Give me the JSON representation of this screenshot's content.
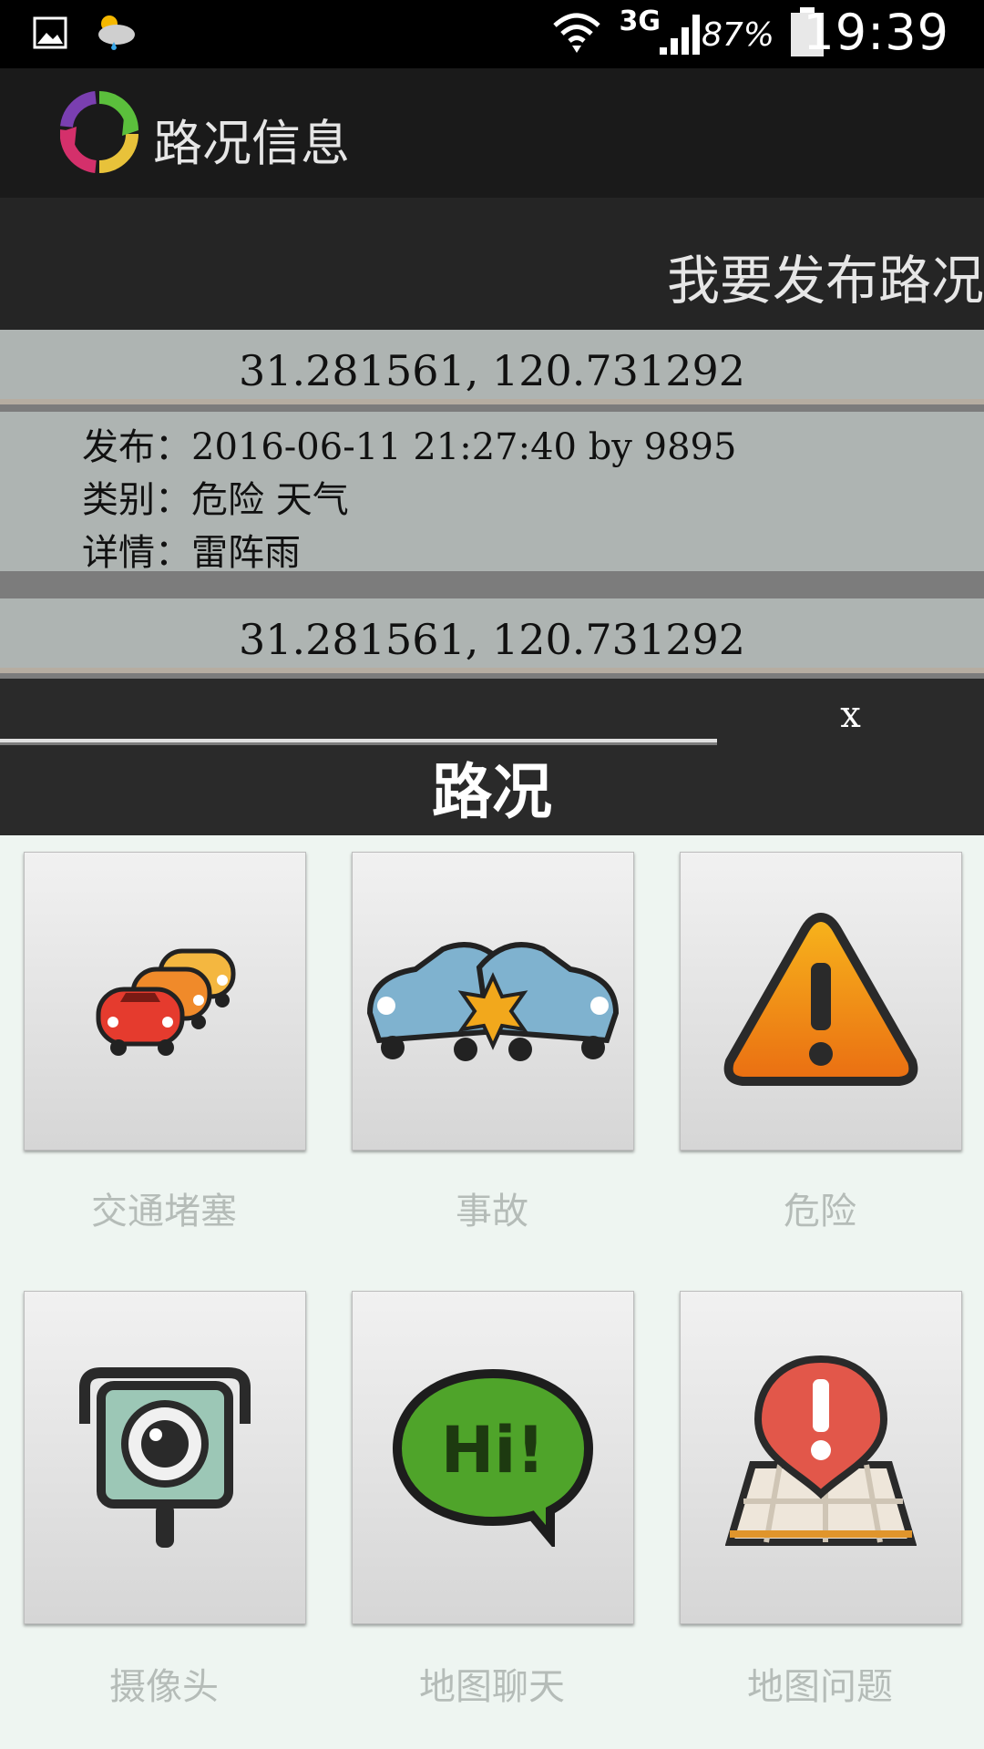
{
  "status_bar": {
    "network": "3G",
    "battery": "87%",
    "time": "19:39",
    "icons": [
      "gallery-icon",
      "weather-icon",
      "wifi-icon",
      "signal-icon",
      "battery-icon"
    ]
  },
  "action_bar": {
    "title": "路况信息",
    "logo_icon": "refresh-arrows-logo"
  },
  "publish": {
    "label": "我要发布路况"
  },
  "list": {
    "items": [
      {
        "coords": "31.281561, 120.731292",
        "published": "发布：2016-06-11 21:27:40 by 9895",
        "category": "类别：危险  天气",
        "details": "详情：雷阵雨"
      },
      {
        "coords": "31.281561, 120.731292"
      }
    ]
  },
  "dialog": {
    "close": "x",
    "title": "路况",
    "options": [
      {
        "label": "交通堵塞",
        "icon": "traffic-jam-icon"
      },
      {
        "label": "事故",
        "icon": "car-accident-icon"
      },
      {
        "label": "危险",
        "icon": "warning-icon"
      },
      {
        "label": "摄像头",
        "icon": "camera-icon"
      },
      {
        "label": "地图聊天",
        "icon": "chat-hi-icon"
      },
      {
        "label": "地图问题",
        "icon": "map-issue-icon"
      }
    ]
  },
  "colors": {
    "status_bar": "#000000",
    "action_bar": "#1a1a1a",
    "list_bg": "#aeb4b2",
    "dialog_bg": "#2a2a2a",
    "grid_bg": "#eef5f1",
    "label_text": "#b5bcb8"
  }
}
